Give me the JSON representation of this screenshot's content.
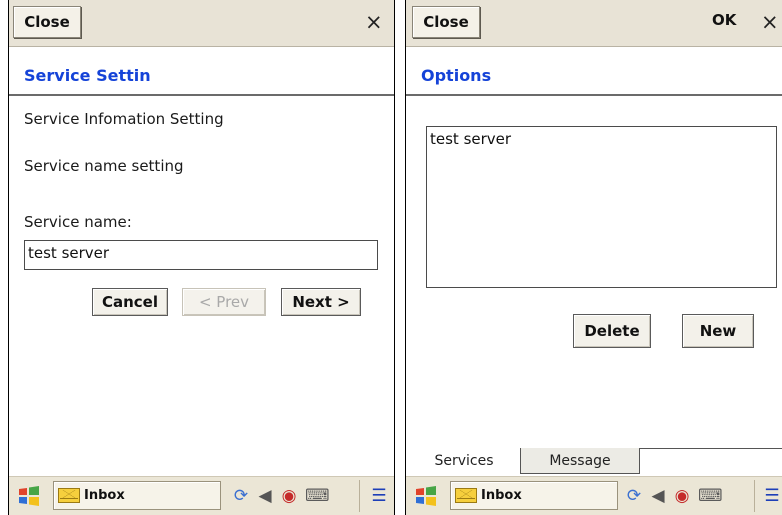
{
  "left_screen": {
    "titlebar": {
      "close_label": "Close",
      "x_glyph": "×"
    },
    "heading": "Service Settin",
    "line1": "Service Infomation Setting",
    "line2": "Service name setting",
    "field_label": "Service name:",
    "field_value": "test server",
    "buttons": {
      "cancel": "Cancel",
      "prev": "< Prev",
      "next": "Next >"
    },
    "taskbar": {
      "inbox": "Inbox"
    }
  },
  "right_screen": {
    "titlebar": {
      "close_label": "Close",
      "ok_label": "OK",
      "x_glyph": "×"
    },
    "heading": "Options",
    "list_items": [
      "test server"
    ],
    "buttons": {
      "delete": "Delete",
      "new": "New"
    },
    "tabs": {
      "services": "Services",
      "message": "Message"
    },
    "taskbar": {
      "inbox": "Inbox"
    }
  },
  "icons": [
    "windows-start-icon",
    "envelope-icon",
    "network-icon",
    "volume-icon",
    "sync-icon",
    "keyboard-icon",
    "windows-switch-icon"
  ],
  "colors": {
    "heading_blue": "#1543d8",
    "titlebar_bg": "#e8e3d6",
    "taskbar_bg": "#ebe6d6"
  }
}
